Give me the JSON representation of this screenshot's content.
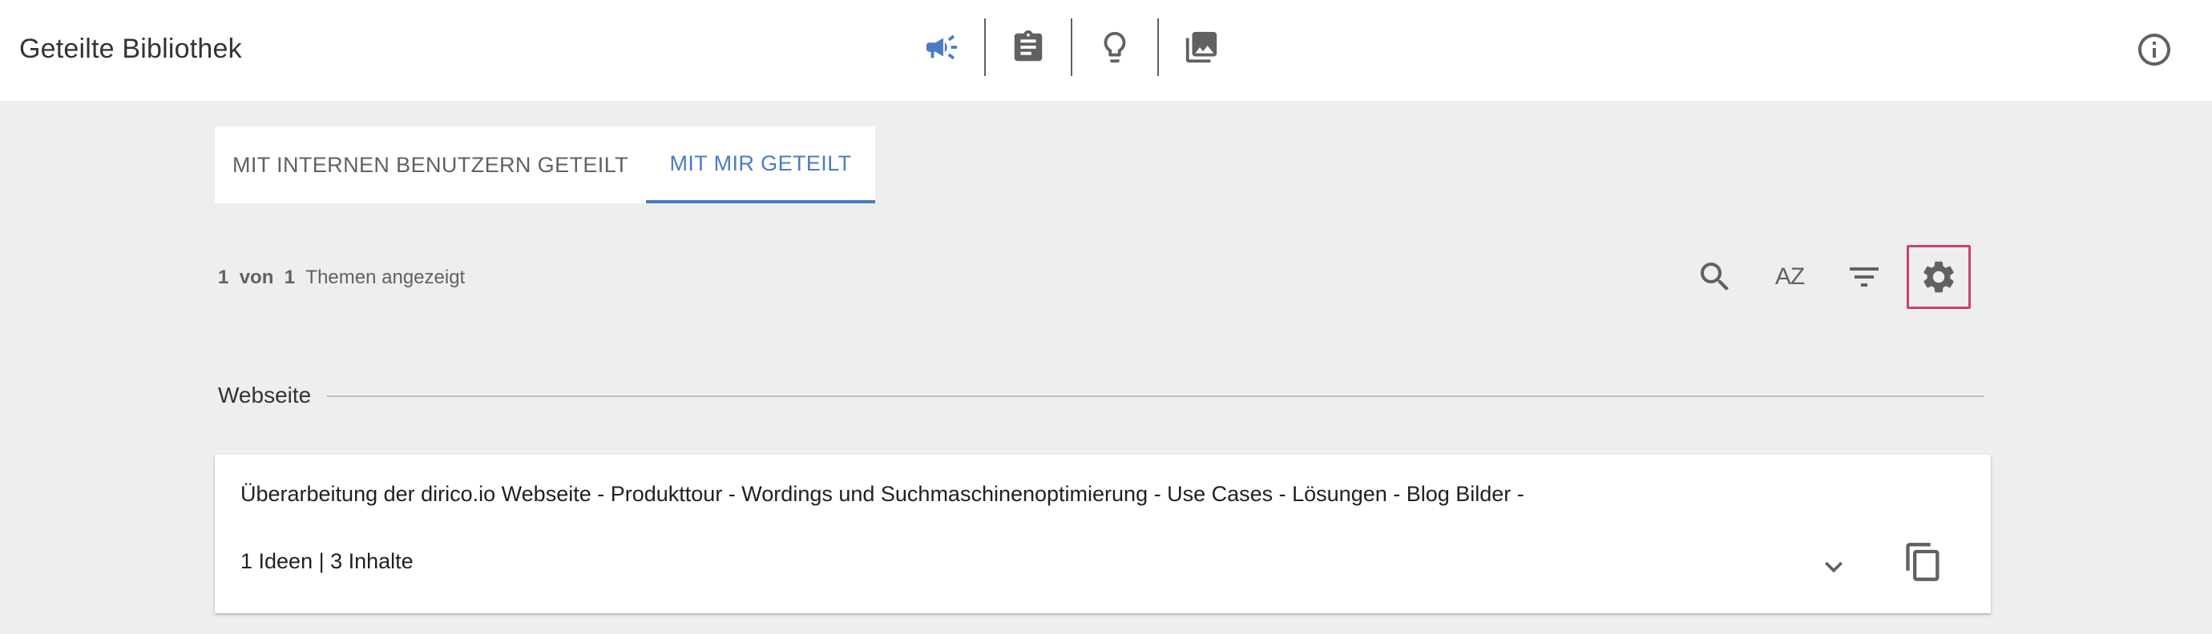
{
  "header": {
    "title": "Geteilte Bibliothek",
    "nav": [
      {
        "icon": "megaphone-icon",
        "active": true
      },
      {
        "icon": "clipboard-icon",
        "active": false
      },
      {
        "icon": "lightbulb-icon",
        "active": false
      },
      {
        "icon": "photo-library-icon",
        "active": false
      }
    ],
    "info_icon": "info-icon"
  },
  "tabs": [
    {
      "label": "MIT INTERNEN BENUTZERN GETEILT",
      "active": false
    },
    {
      "label": "MIT MIR GETEILT",
      "active": true
    }
  ],
  "summary": {
    "shown": "1",
    "of_word": "von",
    "total": "1",
    "suffix": "Themen angezeigt"
  },
  "toolbar": {
    "search_icon": "search-icon",
    "sort_label": "AZ",
    "filter_icon": "filter-icon",
    "settings_icon": "gear-icon"
  },
  "section": {
    "label": "Webseite"
  },
  "topic_card": {
    "title": "Überarbeitung der dirico.io Webseite - Produkttour - Wordings und Suchmaschinenoptimierung - Use Cases - Lösungen - Blog Bilder -",
    "meta": "1 Ideen | 3 Inhalte"
  },
  "colors": {
    "accent": "#4a7bc8",
    "highlight_border": "#c9426e",
    "background": "#eeeeee",
    "icon": "#616161"
  }
}
